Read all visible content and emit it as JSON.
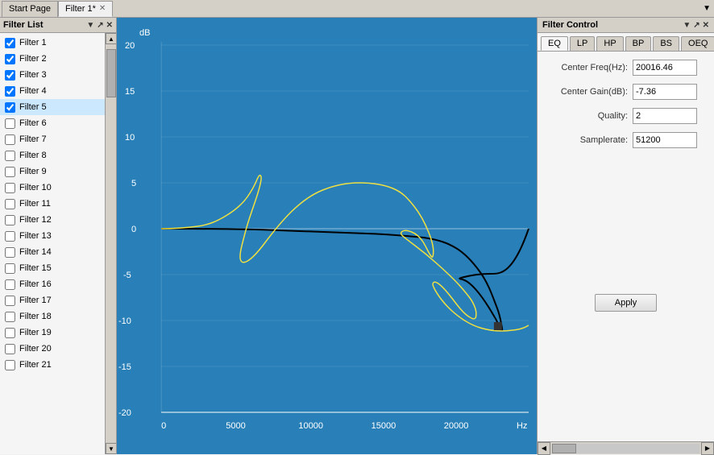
{
  "tabs": [
    {
      "id": "start",
      "label": "Start Page",
      "closable": false,
      "active": false
    },
    {
      "id": "filter1",
      "label": "Filter 1*",
      "closable": true,
      "active": true
    }
  ],
  "tab_dropdown_icon": "▼",
  "filter_list": {
    "title": "Filter List",
    "icons": [
      "▼",
      "↗",
      "✕"
    ],
    "items": [
      {
        "id": 1,
        "label": "Filter 1",
        "checked": true
      },
      {
        "id": 2,
        "label": "Filter 2",
        "checked": true
      },
      {
        "id": 3,
        "label": "Filter 3",
        "checked": true
      },
      {
        "id": 4,
        "label": "Filter 4",
        "checked": true
      },
      {
        "id": 5,
        "label": "Filter 5",
        "checked": true,
        "active": true
      },
      {
        "id": 6,
        "label": "Filter 6",
        "checked": false
      },
      {
        "id": 7,
        "label": "Filter 7",
        "checked": false
      },
      {
        "id": 8,
        "label": "Filter 8",
        "checked": false
      },
      {
        "id": 9,
        "label": "Filter 9",
        "checked": false
      },
      {
        "id": 10,
        "label": "Filter 10",
        "checked": false
      },
      {
        "id": 11,
        "label": "Filter 11",
        "checked": false
      },
      {
        "id": 12,
        "label": "Filter 12",
        "checked": false
      },
      {
        "id": 13,
        "label": "Filter 13",
        "checked": false
      },
      {
        "id": 14,
        "label": "Filter 14",
        "checked": false
      },
      {
        "id": 15,
        "label": "Filter 15",
        "checked": false
      },
      {
        "id": 16,
        "label": "Filter 16",
        "checked": false
      },
      {
        "id": 17,
        "label": "Filter 17",
        "checked": false
      },
      {
        "id": 18,
        "label": "Filter 18",
        "checked": false
      },
      {
        "id": 19,
        "label": "Filter 19",
        "checked": false
      },
      {
        "id": 20,
        "label": "Filter 20",
        "checked": false
      },
      {
        "id": 21,
        "label": "Filter 21",
        "checked": false
      }
    ]
  },
  "chart": {
    "db_label": "dB",
    "hz_label": "Hz",
    "y_labels": [
      "20",
      "15",
      "10",
      "5",
      "0",
      "-5",
      "-10",
      "-15",
      "-20"
    ],
    "x_labels": [
      "0",
      "5000",
      "10000",
      "15000",
      "20000"
    ]
  },
  "filter_control": {
    "title": "Filter Control",
    "icons": [
      "▼",
      "↗",
      "✕"
    ],
    "tabs": [
      "EQ",
      "LP",
      "HP",
      "BP",
      "BS",
      "OEQ"
    ],
    "active_tab": "EQ",
    "fields": [
      {
        "label": "Center Freq(Hz):",
        "value": "20016.46"
      },
      {
        "label": "Center Gain(dB):",
        "value": "-7.36"
      },
      {
        "label": "Quality:",
        "value": "2"
      },
      {
        "label": "Samplerate:",
        "value": "51200"
      }
    ],
    "apply_label": "Apply"
  }
}
